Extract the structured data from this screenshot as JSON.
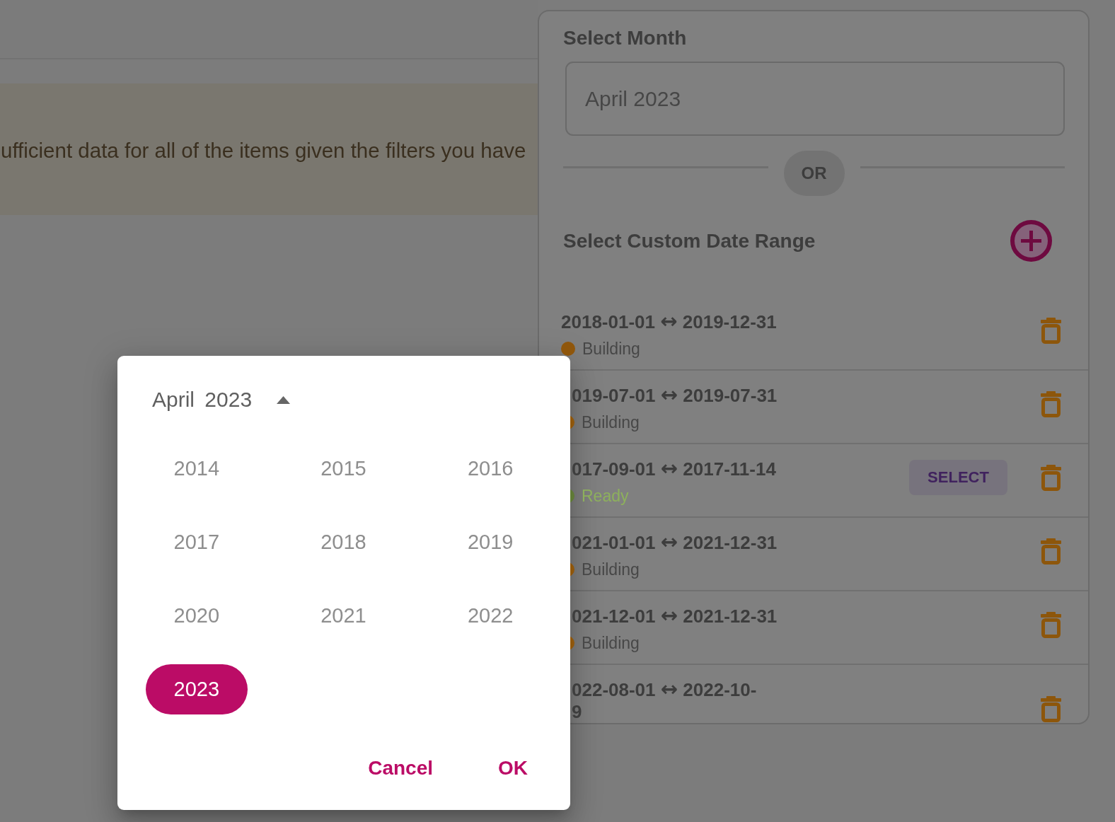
{
  "banner": {
    "message": "ufficient data for all of the items given the filters you have"
  },
  "range_panel": {
    "month_title": "Select Month",
    "month_field": {
      "value": "April 2023"
    },
    "separator": "OR",
    "custom_title": "Select Custom Date Range",
    "ranges": [
      {
        "start": "2018-01-01",
        "arrow": "↔",
        "end": "2019-12-31",
        "status": {
          "label": "Building",
          "kind": "building",
          "color": "#8f560b"
        }
      },
      {
        "start": "019-07-01",
        "arrow": "↔",
        "end": "2019-07-31",
        "status": {
          "label": "Building",
          "kind": "building",
          "color": "#8f560b"
        }
      },
      {
        "start": "017-09-01",
        "arrow": "↔",
        "end": "2017-11-14",
        "status": {
          "label": "Ready",
          "kind": "ready",
          "color": "#5f7a35"
        },
        "action": "SELECT"
      },
      {
        "start": "021-01-01",
        "arrow": "↔",
        "end": "2021-12-31",
        "status": {
          "label": "Building",
          "kind": "building",
          "color": "#8f560b"
        }
      },
      {
        "start": "021-12-01",
        "arrow": "↔",
        "end": "2021-12-31",
        "status": {
          "label": "Building",
          "kind": "building",
          "color": "#8f560b"
        }
      },
      {
        "start": "022-08-01",
        "arrow": "↔",
        "end": "2022-10-\n9"
      }
    ]
  },
  "year_picker": {
    "heading": "April 2023",
    "years": [
      {
        "label": "2014",
        "selected": false
      },
      {
        "label": "2015",
        "selected": false
      },
      {
        "label": "2016",
        "selected": false
      },
      {
        "label": "2017",
        "selected": false
      },
      {
        "label": "2018",
        "selected": false
      },
      {
        "label": "2019",
        "selected": false
      },
      {
        "label": "2020",
        "selected": false
      },
      {
        "label": "2021",
        "selected": false
      },
      {
        "label": "2022",
        "selected": false
      },
      {
        "label": "2023",
        "selected": true
      }
    ],
    "buttons": [
      "Cancel",
      "OK"
    ]
  }
}
